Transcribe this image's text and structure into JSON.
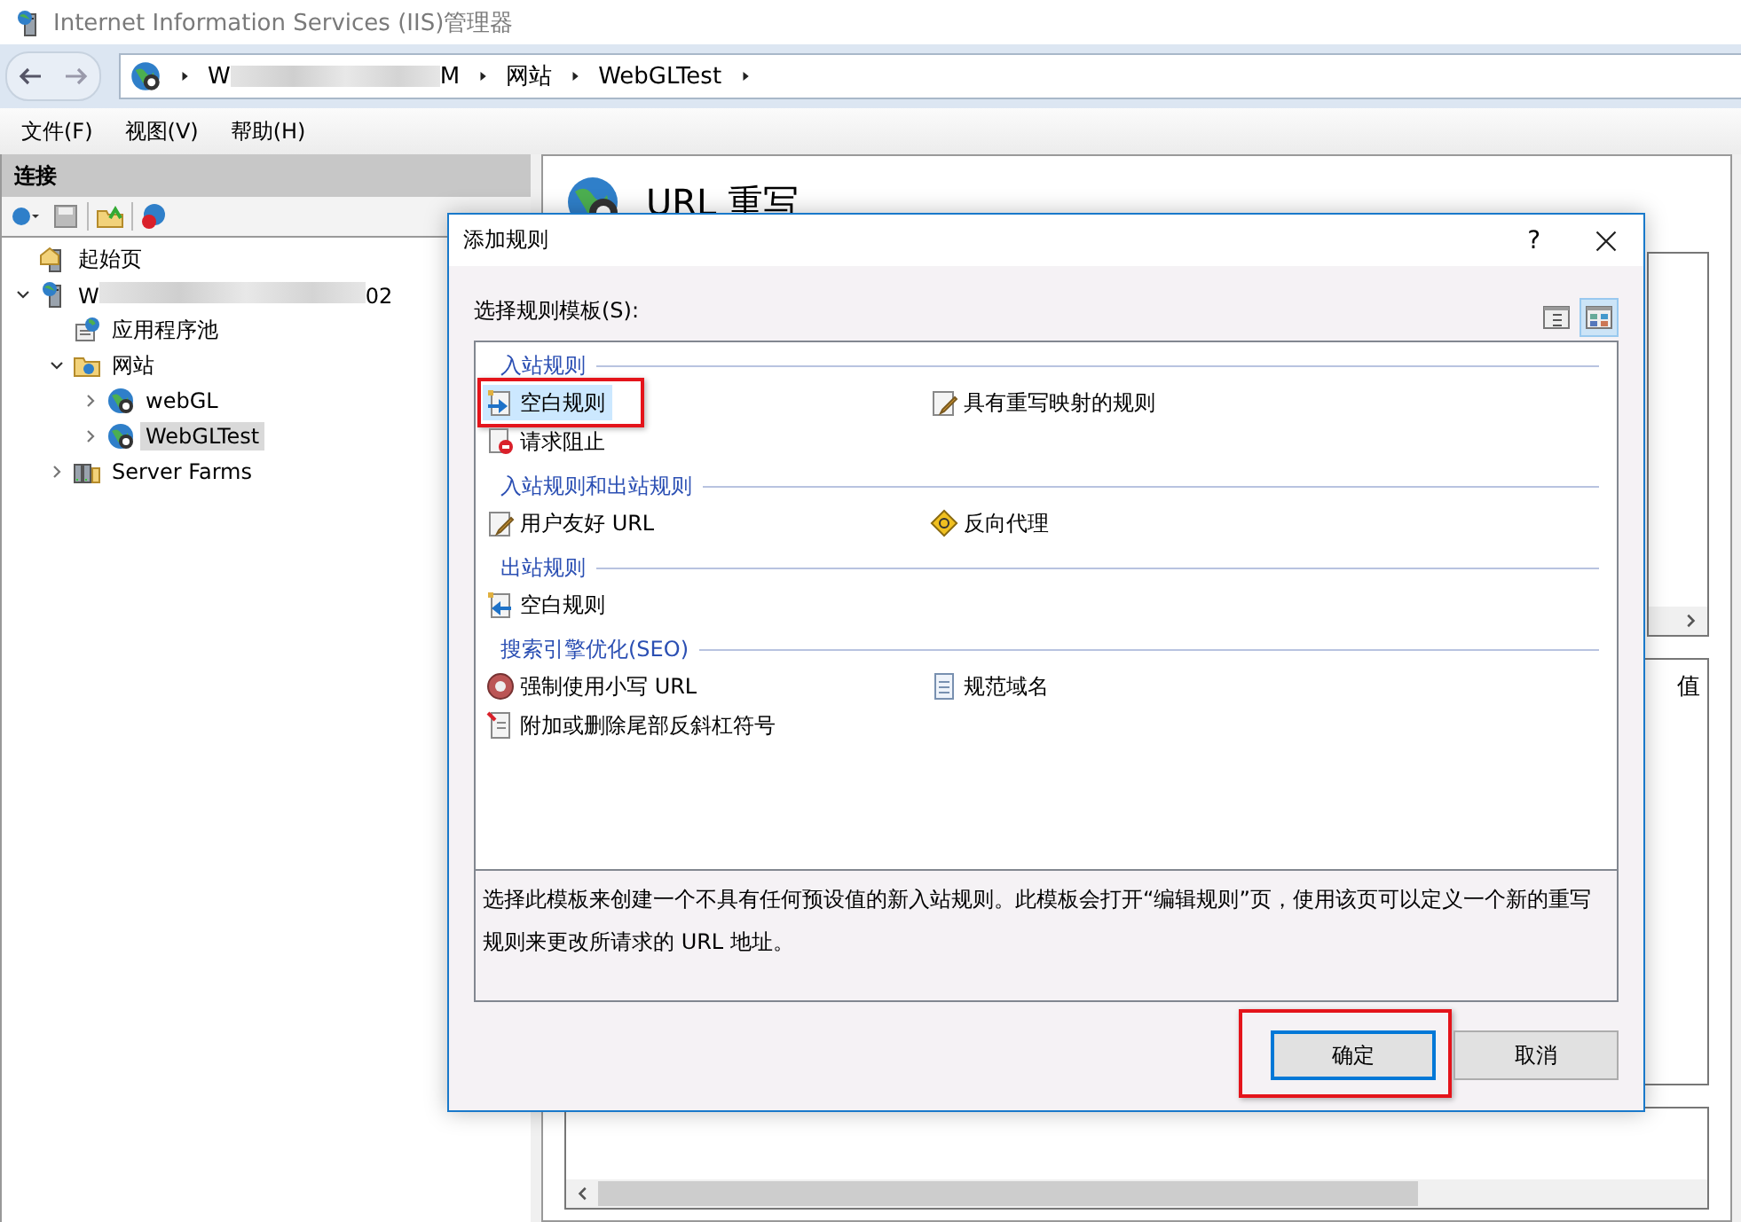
{
  "window": {
    "title": "Internet Information Services (IIS)管理器"
  },
  "address_bar": {
    "crumbs": [
      {
        "kind": "redacted",
        "start": "W",
        "end": "M"
      },
      {
        "kind": "text",
        "text": "网站"
      },
      {
        "kind": "text",
        "text": "WebGLTest"
      }
    ]
  },
  "menu": [
    "文件(F)",
    "视图(V)",
    "帮助(H)"
  ],
  "connections": {
    "title": "连接",
    "tree": [
      {
        "kind": "start",
        "label": "起始页",
        "selected": false
      },
      {
        "kind": "server",
        "label_start": "W",
        "label_end": "02",
        "redacted": true,
        "expanded": true,
        "selected": false,
        "children": [
          {
            "kind": "pool",
            "label": "应用程序池",
            "selected": false
          },
          {
            "kind": "sites",
            "label": "网站",
            "expanded": true,
            "selected": false,
            "children": [
              {
                "kind": "site",
                "label": "webGL",
                "expanded": false,
                "selected": false
              },
              {
                "kind": "site",
                "label": "WebGLTest",
                "expanded": false,
                "selected": true
              }
            ]
          },
          {
            "kind": "farms",
            "label": "Server Farms",
            "expanded": false,
            "selected": false
          }
        ]
      }
    ]
  },
  "main": {
    "title": "URL 重写",
    "fragment": "值"
  },
  "dialog": {
    "title": "添加规则",
    "help": "?",
    "label": "选择规则模板(S):",
    "views": [
      {
        "selected": false
      },
      {
        "selected": true
      }
    ],
    "groups": [
      {
        "title": "入站规则",
        "items": [
          {
            "kind": "blank-in",
            "label": "空白规则",
            "selected": true,
            "annotated": true
          },
          {
            "kind": "map",
            "label": "具有重写映射的规则",
            "selected": false,
            "annotated": false
          },
          {
            "kind": "block",
            "label": "请求阻止",
            "selected": false,
            "annotated": false
          }
        ]
      },
      {
        "title": "入站规则和出站规则",
        "items": [
          {
            "kind": "edit",
            "label": "用户友好 URL",
            "selected": false,
            "annotated": false
          },
          {
            "kind": "proxy",
            "label": "反向代理",
            "selected": false,
            "annotated": false
          }
        ]
      },
      {
        "title": "出站规则",
        "items": [
          {
            "kind": "blank-out",
            "label": "空白规则",
            "selected": false,
            "annotated": false
          }
        ]
      },
      {
        "title": "搜索引擎优化(SEO)",
        "items": [
          {
            "kind": "lower",
            "label": "强制使用小写 URL",
            "selected": false,
            "annotated": false
          },
          {
            "kind": "doc",
            "label": "规范域名",
            "selected": false,
            "annotated": false
          },
          {
            "kind": "slash",
            "label": "附加或删除尾部反斜杠符号",
            "selected": false,
            "annotated": false
          }
        ]
      }
    ],
    "description": "选择此模板来创建一个不具有任何预设值的新入站规则。此模板会打开“编辑规则”页，使用该页可以定义一个新的重写规则来更改所请求的 URL 地址。",
    "buttons": [
      {
        "label": "确定",
        "default": true,
        "annotated": true
      },
      {
        "label": "取消",
        "default": false,
        "annotated": false
      }
    ]
  }
}
